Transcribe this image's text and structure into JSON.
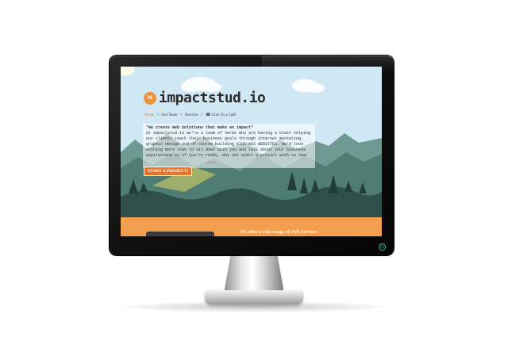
{
  "site": {
    "logo_badge": "IS",
    "logo_text": "impactstud.io"
  },
  "nav": {
    "items": [
      {
        "label": "Home",
        "active": true
      },
      {
        "label": "Our Team"
      },
      {
        "label": "Services"
      },
      {
        "label": "Give Us a Call!"
      }
    ],
    "separator": "//",
    "phone_icon": "☎"
  },
  "hero": {
    "headline": "\"We create Web Solutions that make an impact\"",
    "body": "At impactstud.io we're a team of nerds who are having a blast helping our clients reach their business goals through internet marketing, graphic design and of course building KICK ASS WEBSITES. We'd love nothing more than to sit down with you and talk about your business aspirations so if you're ready, why not start a project with us now!"
  },
  "cta": {
    "label": "START A PROJECT!"
  },
  "footer": {
    "text": "We offer a wide range of Web Services"
  },
  "colors": {
    "accent": "#e8742a",
    "sky": "#cfe8f3",
    "mountain_dark": "#2f4f4a",
    "mountain_mid": "#4f7d73",
    "footer_band": "#f2a04f",
    "power_led": "#2dbf9f"
  },
  "icons": {
    "power": "power-icon"
  }
}
